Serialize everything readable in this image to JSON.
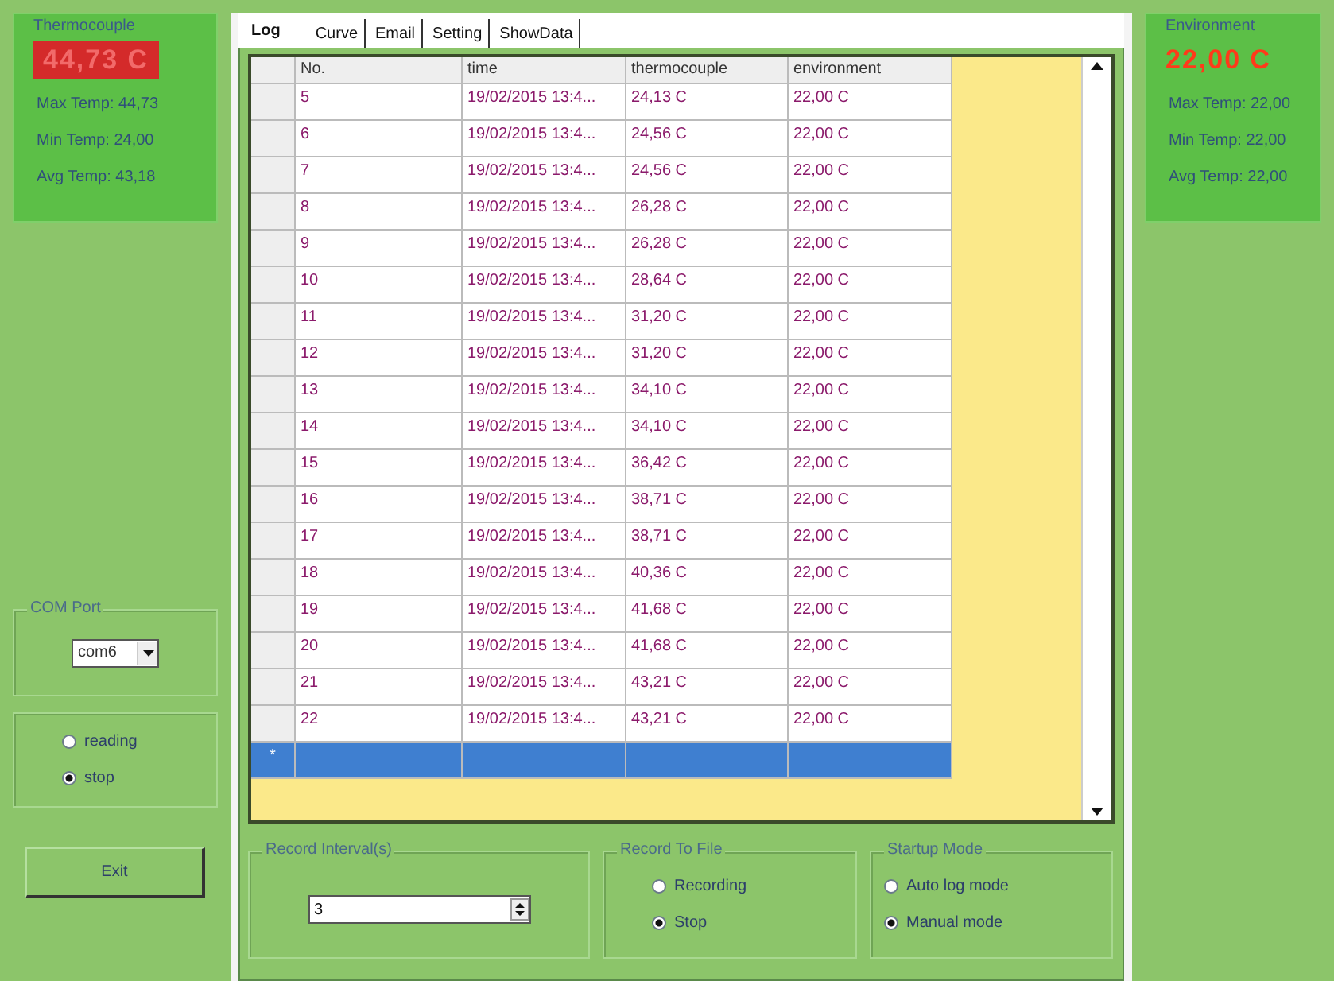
{
  "thermocouple": {
    "title": "Thermocouple",
    "value": "44,73 C",
    "stats": [
      "Max Temp: 44,73",
      "Min Temp: 24,00",
      "Avg Temp: 43,18"
    ]
  },
  "com_port": {
    "title": "COM Port",
    "value": "com6"
  },
  "read_mode": [
    {
      "label": "reading",
      "selected": false
    },
    {
      "label": "stop",
      "selected": true
    }
  ],
  "exit_button": "Exit",
  "tabs": [
    {
      "label": "Log",
      "selected": true
    },
    {
      "label": "Curve",
      "selected": false
    },
    {
      "label": "Email",
      "selected": false
    },
    {
      "label": "Setting",
      "selected": false
    },
    {
      "label": "ShowData",
      "selected": false
    }
  ],
  "table": {
    "columns": [
      "No.",
      "time",
      "thermocouple",
      "environment"
    ],
    "rows": [
      [
        "5",
        "19/02/2015 13:4...",
        "24,13 C",
        "22,00 C"
      ],
      [
        "6",
        "19/02/2015 13:4...",
        "24,56 C",
        "22,00 C"
      ],
      [
        "7",
        "19/02/2015 13:4...",
        "24,56 C",
        "22,00 C"
      ],
      [
        "8",
        "19/02/2015 13:4...",
        "26,28 C",
        "22,00 C"
      ],
      [
        "9",
        "19/02/2015 13:4...",
        "26,28 C",
        "22,00 C"
      ],
      [
        "10",
        "19/02/2015 13:4...",
        "28,64 C",
        "22,00 C"
      ],
      [
        "11",
        "19/02/2015 13:4...",
        "31,20 C",
        "22,00 C"
      ],
      [
        "12",
        "19/02/2015 13:4...",
        "31,20 C",
        "22,00 C"
      ],
      [
        "13",
        "19/02/2015 13:4...",
        "34,10 C",
        "22,00 C"
      ],
      [
        "14",
        "19/02/2015 13:4...",
        "34,10 C",
        "22,00 C"
      ],
      [
        "15",
        "19/02/2015 13:4...",
        "36,42 C",
        "22,00 C"
      ],
      [
        "16",
        "19/02/2015 13:4...",
        "38,71 C",
        "22,00 C"
      ],
      [
        "17",
        "19/02/2015 13:4...",
        "38,71 C",
        "22,00 C"
      ],
      [
        "18",
        "19/02/2015 13:4...",
        "40,36 C",
        "22,00 C"
      ],
      [
        "19",
        "19/02/2015 13:4...",
        "41,68 C",
        "22,00 C"
      ],
      [
        "20",
        "19/02/2015 13:4...",
        "41,68 C",
        "22,00 C"
      ],
      [
        "21",
        "19/02/2015 13:4...",
        "43,21 C",
        "22,00 C"
      ],
      [
        "22",
        "19/02/2015 13:4...",
        "43,21 C",
        "22,00 C"
      ]
    ],
    "new_row": {
      "marker": "*",
      "selected": true
    }
  },
  "record_interval": {
    "title": "Record Interval(s)",
    "value": "3"
  },
  "record_to_file": {
    "title": "Record To File",
    "options": [
      {
        "label": "Recording",
        "selected": false
      },
      {
        "label": "Stop",
        "selected": true
      }
    ]
  },
  "startup_mode": {
    "title": "Startup Mode",
    "options": [
      {
        "label": "Auto log mode",
        "selected": false
      },
      {
        "label": "Manual mode",
        "selected": true
      }
    ]
  },
  "environment": {
    "title": "Environment",
    "value": "22,00 C",
    "stats": [
      "Max Temp: 22,00",
      "Min Temp: 22,00",
      "Avg Temp: 22,00"
    ]
  }
}
